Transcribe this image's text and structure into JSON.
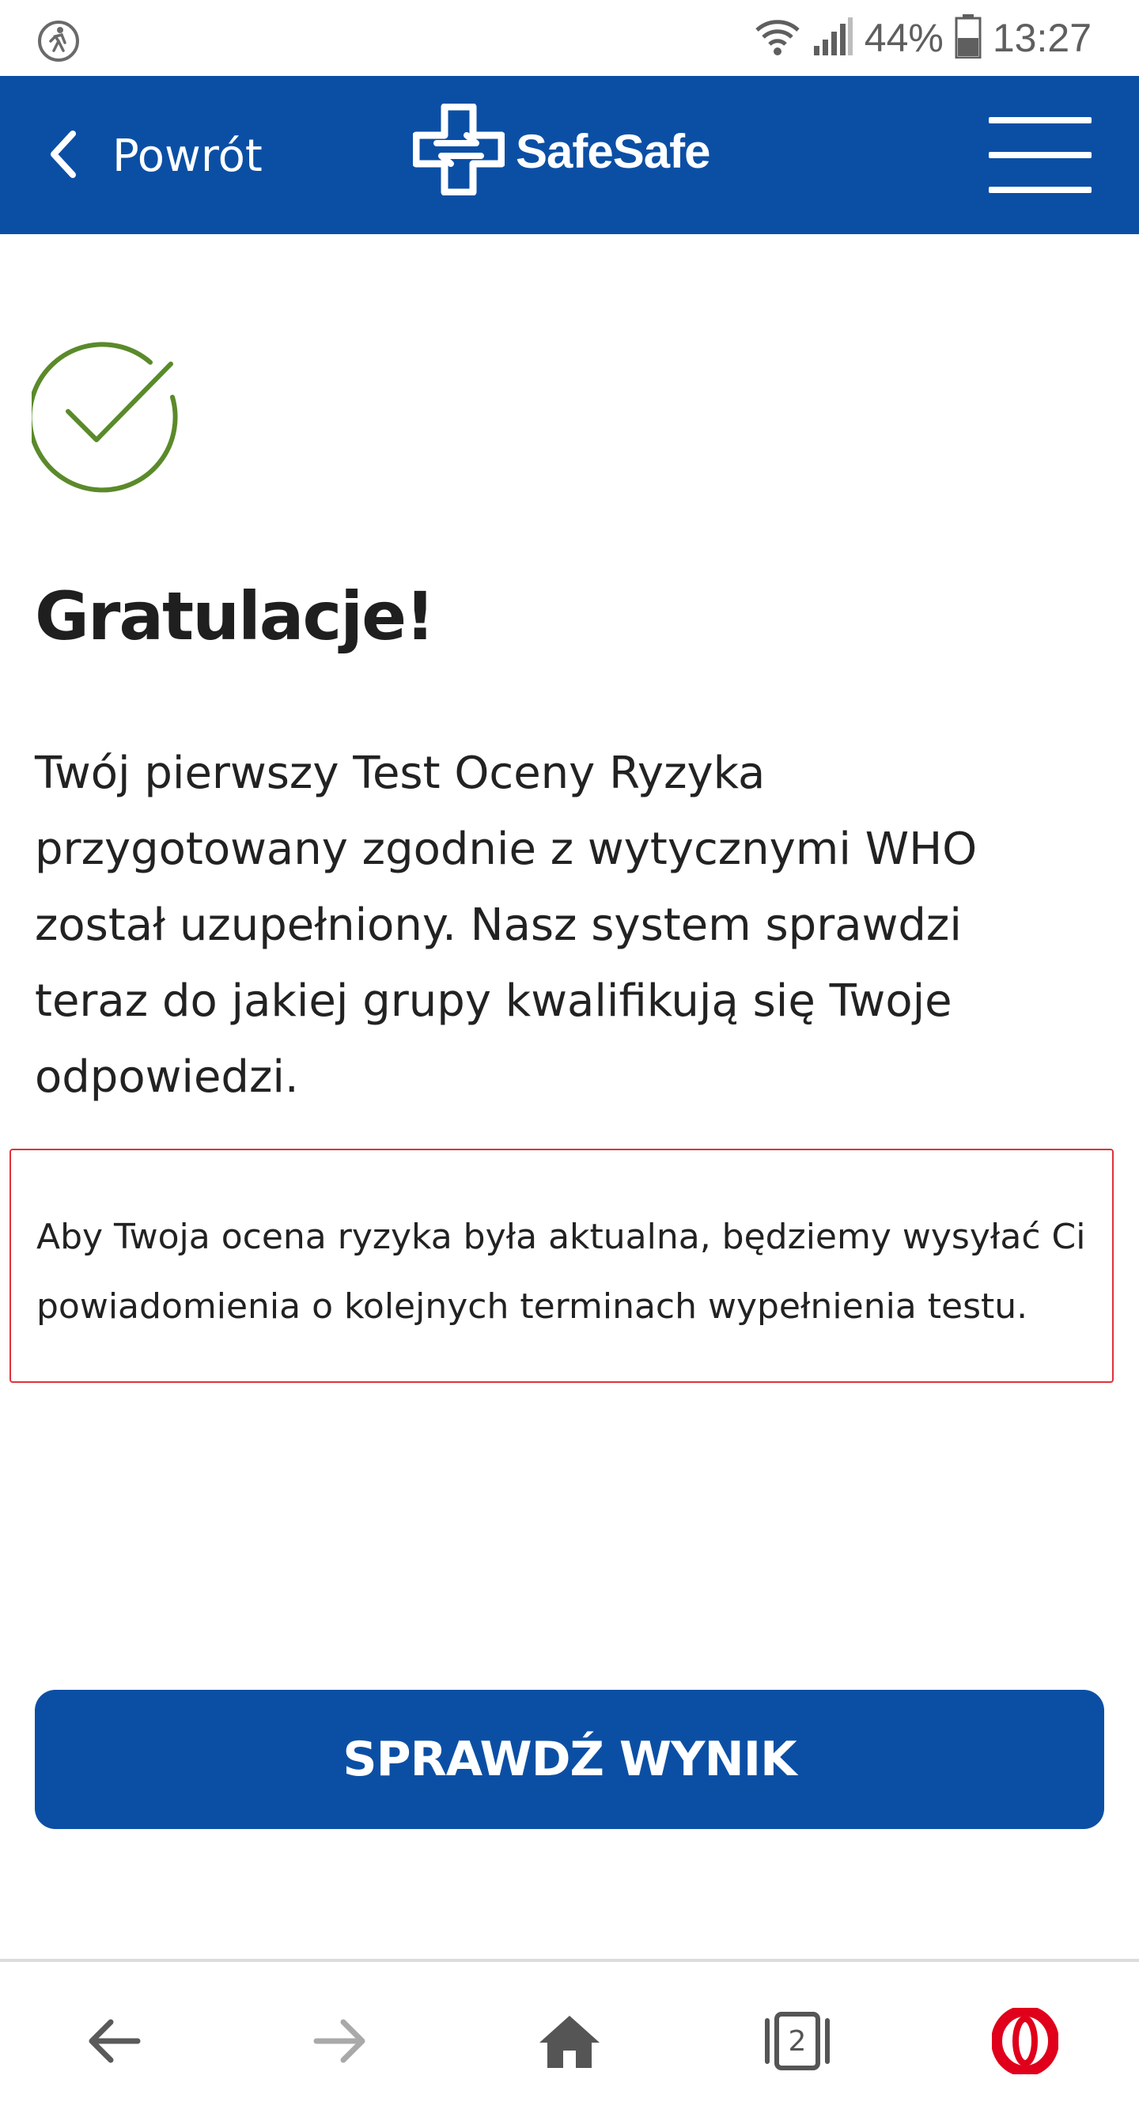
{
  "status_bar": {
    "battery_percent": "44%",
    "time": "13:27",
    "icons": [
      "accessibility-icon",
      "wifi-icon",
      "signal-icon",
      "battery-icon"
    ]
  },
  "header": {
    "back_label": "Powrót",
    "app_name": "SafeSafe",
    "background": "#0b4fa5"
  },
  "main": {
    "title": "Gratulacje!",
    "body_lines": [
      "Twój pierwszy Test Oceny Ryzyka",
      "przygotowany zgodnie z wytycznymi WHO",
      "został uzupełniony. Nasz system sprawdzi",
      "teraz do jakiej grupy kwalifikują się Twoje",
      "odpowiedzi."
    ],
    "notice_lines": [
      "Aby Twoja ocena ryzyka była aktualna, będziemy wysyłać Ci",
      "powiadomienia o kolejnych terminach wypełnienia testu."
    ],
    "success_color": "#5a8a2a",
    "notice_border_color": "#e0323a"
  },
  "cta": {
    "label": "SPRAWDŹ WYNIK"
  },
  "browser_bar": {
    "tab_count": "2",
    "opera_color": "#e0001b"
  }
}
